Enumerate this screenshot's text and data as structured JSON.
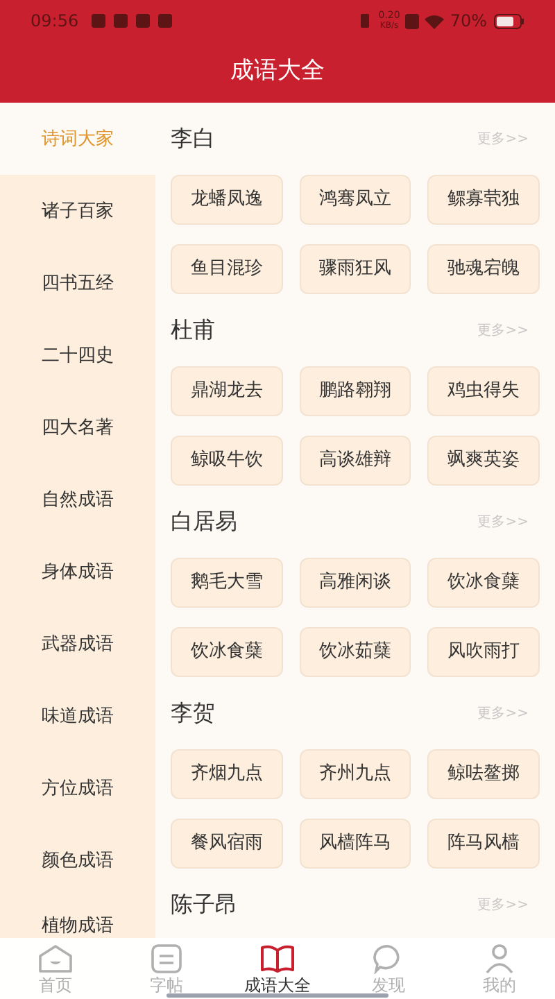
{
  "status_bar": {
    "time": "09:56",
    "speed": "0.20",
    "speed_unit": "KB/s",
    "battery": "70%"
  },
  "title": "成语大全",
  "sidebar": {
    "items": [
      {
        "label": "诗词大家",
        "selected": true
      },
      {
        "label": "诸子百家",
        "selected": false
      },
      {
        "label": "四书五经",
        "selected": false
      },
      {
        "label": "二十四史",
        "selected": false
      },
      {
        "label": "四大名著",
        "selected": false
      },
      {
        "label": "自然成语",
        "selected": false
      },
      {
        "label": "身体成语",
        "selected": false
      },
      {
        "label": "武器成语",
        "selected": false
      },
      {
        "label": "味道成语",
        "selected": false
      },
      {
        "label": "方位成语",
        "selected": false
      },
      {
        "label": "颜色成语",
        "selected": false
      },
      {
        "label": "植物成语",
        "selected": false
      }
    ]
  },
  "sections": [
    {
      "name": "李白",
      "more": "更多>>",
      "idioms": [
        "龙蟠凤逸",
        "鸿骞凤立",
        "鳏寡茕独",
        "鱼目混珍",
        "骤雨狂风",
        "驰魂宕魄"
      ]
    },
    {
      "name": "杜甫",
      "more": "更多>>",
      "idioms": [
        "鼎湖龙去",
        "鹏路翱翔",
        "鸡虫得失",
        "鲸吸牛饮",
        "高谈雄辩",
        "飒爽英姿"
      ]
    },
    {
      "name": "白居易",
      "more": "更多>>",
      "idioms": [
        "鹅毛大雪",
        "高雅闲谈",
        "饮冰食蘖",
        "饮冰食蘖",
        "饮冰茹蘖",
        "风吹雨打"
      ]
    },
    {
      "name": "李贺",
      "more": "更多>>",
      "idioms": [
        "齐烟九点",
        "齐州九点",
        "鲸呿鳌掷",
        "餐风宿雨",
        "风樯阵马",
        "阵马风樯"
      ]
    },
    {
      "name": "陈子昂",
      "more": "更多>>"
    }
  ],
  "tab_bar": [
    {
      "kind": "home",
      "label": "首页",
      "selected": false
    },
    {
      "kind": "copybook",
      "label": "字帖",
      "selected": false
    },
    {
      "kind": "book",
      "label": "成语大全",
      "selected": true
    },
    {
      "kind": "discover",
      "label": "发现",
      "selected": false
    },
    {
      "kind": "profile",
      "label": "我的",
      "selected": false
    }
  ]
}
